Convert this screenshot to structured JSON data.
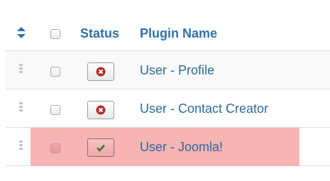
{
  "header": {
    "status_label": "Status",
    "plugin_name_label": "Plugin Name"
  },
  "rows": [
    {
      "name": "User - Profile",
      "status": "disabled",
      "status_icon": "cross-circle-icon"
    },
    {
      "name": "User - Contact Creator",
      "status": "disabled",
      "status_icon": "cross-circle-icon"
    },
    {
      "name": "User - Joomla!",
      "status": "enabled",
      "status_icon": "checkmark-icon",
      "highlighted": true
    }
  ],
  "colors": {
    "link": "#2f6a9a",
    "header": "#3071a9",
    "disabled_icon": "#b52a2a",
    "enabled_icon": "#3b7a2b",
    "highlight": "#f6b4b4"
  }
}
